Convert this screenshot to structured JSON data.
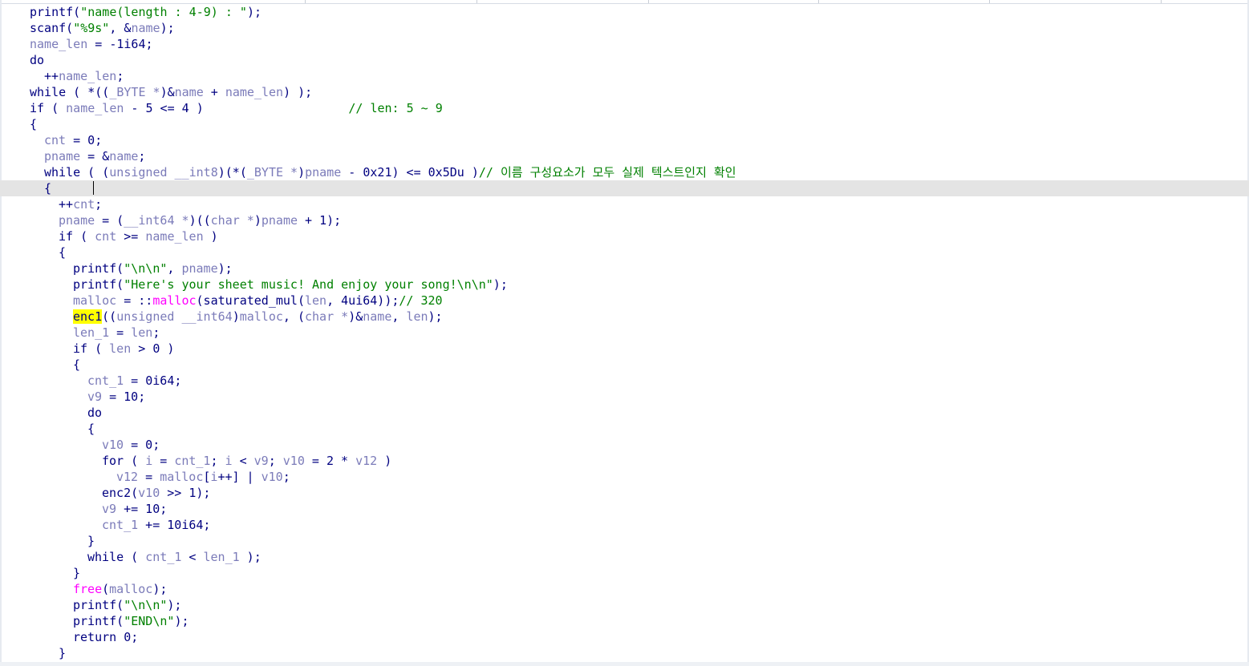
{
  "editor": {
    "current_line": 11,
    "lines": [
      {
        "indent": 0,
        "tokens": [
          [
            "kw",
            "printf("
          ],
          [
            "str",
            "\"name(length : 4-9) : \""
          ],
          [
            "kw",
            ");"
          ]
        ]
      },
      {
        "indent": 0,
        "tokens": [
          [
            "kw",
            "scanf("
          ],
          [
            "str",
            "\"%9s\""
          ],
          [
            "kw",
            ", &"
          ],
          [
            "var",
            "name"
          ],
          [
            "kw",
            ");"
          ]
        ]
      },
      {
        "indent": 0,
        "tokens": [
          [
            "var",
            "name_len"
          ],
          [
            "kw",
            " = -1i64;"
          ]
        ]
      },
      {
        "indent": 0,
        "tokens": [
          [
            "kw",
            "do"
          ]
        ]
      },
      {
        "indent": 1,
        "tokens": [
          [
            "kw",
            "++"
          ],
          [
            "var",
            "name_len"
          ],
          [
            "kw",
            ";"
          ]
        ]
      },
      {
        "indent": 0,
        "tokens": [
          [
            "kw",
            "while ( *(("
          ],
          [
            "var",
            "_BYTE *"
          ],
          [
            "kw",
            ")&"
          ],
          [
            "var",
            "name"
          ],
          [
            "kw",
            " + "
          ],
          [
            "var",
            "name_len"
          ],
          [
            "kw",
            ") );"
          ]
        ]
      },
      {
        "indent": 0,
        "tokens": [
          [
            "kw",
            "if ( "
          ],
          [
            "var",
            "name_len"
          ],
          [
            "kw",
            " - 5 <= 4 )                    "
          ],
          [
            "com",
            "// len: 5 ~ 9"
          ]
        ]
      },
      {
        "indent": 0,
        "tokens": [
          [
            "kw",
            "{"
          ]
        ]
      },
      {
        "indent": 1,
        "tokens": [
          [
            "var",
            "cnt"
          ],
          [
            "kw",
            " = 0;"
          ]
        ]
      },
      {
        "indent": 1,
        "tokens": [
          [
            "var",
            "pname"
          ],
          [
            "kw",
            " = &"
          ],
          [
            "var",
            "name"
          ],
          [
            "kw",
            ";"
          ]
        ]
      },
      {
        "indent": 1,
        "tokens": [
          [
            "kw",
            "while ( ("
          ],
          [
            "var",
            "unsigned __int8"
          ],
          [
            "kw",
            ")(*("
          ],
          [
            "var",
            "_BYTE *"
          ],
          [
            "kw",
            ")"
          ],
          [
            "var",
            "pname"
          ],
          [
            "kw",
            " - 0x21) <= 0x5Du )"
          ],
          [
            "com",
            "// 이름 구성요소가 모두 실제 텍스트인지 확인"
          ]
        ]
      },
      {
        "indent": 1,
        "tokens": [
          [
            "kw",
            "{"
          ]
        ],
        "caret": true
      },
      {
        "indent": 2,
        "tokens": [
          [
            "kw",
            "++"
          ],
          [
            "var",
            "cnt"
          ],
          [
            "kw",
            ";"
          ]
        ]
      },
      {
        "indent": 2,
        "tokens": [
          [
            "var",
            "pname"
          ],
          [
            "kw",
            " = ("
          ],
          [
            "var",
            "__int64 *"
          ],
          [
            "kw",
            ")(("
          ],
          [
            "var",
            "char *"
          ],
          [
            "kw",
            ")"
          ],
          [
            "var",
            "pname"
          ],
          [
            "kw",
            " + 1);"
          ]
        ]
      },
      {
        "indent": 2,
        "tokens": [
          [
            "kw",
            "if ( "
          ],
          [
            "var",
            "cnt"
          ],
          [
            "kw",
            " >= "
          ],
          [
            "var",
            "name_len"
          ],
          [
            "kw",
            " )"
          ]
        ]
      },
      {
        "indent": 2,
        "tokens": [
          [
            "kw",
            "{"
          ]
        ]
      },
      {
        "indent": 3,
        "tokens": [
          [
            "kw",
            "printf("
          ],
          [
            "str",
            "\"\\n\\n\""
          ],
          [
            "kw",
            ", "
          ],
          [
            "var",
            "pname"
          ],
          [
            "kw",
            ");"
          ]
        ]
      },
      {
        "indent": 3,
        "tokens": [
          [
            "kw",
            "printf("
          ],
          [
            "str",
            "\"Here's your sheet music! And enjoy your song!\\n\\n\""
          ],
          [
            "kw",
            ");"
          ]
        ]
      },
      {
        "indent": 3,
        "tokens": [
          [
            "var",
            "malloc"
          ],
          [
            "kw",
            " = ::"
          ],
          [
            "func",
            "malloc"
          ],
          [
            "kw",
            "(saturated_mul("
          ],
          [
            "var",
            "len"
          ],
          [
            "kw",
            ", 4ui64));"
          ],
          [
            "com",
            "// 320"
          ]
        ]
      },
      {
        "indent": 3,
        "tokens": [
          [
            "hl",
            "enc1"
          ],
          [
            "kw",
            "(("
          ],
          [
            "var",
            "unsigned __int64"
          ],
          [
            "kw",
            ")"
          ],
          [
            "var",
            "malloc"
          ],
          [
            "kw",
            ", ("
          ],
          [
            "var",
            "char *"
          ],
          [
            "kw",
            ")&"
          ],
          [
            "var",
            "name"
          ],
          [
            "kw",
            ", "
          ],
          [
            "var",
            "len"
          ],
          [
            "kw",
            ");"
          ]
        ]
      },
      {
        "indent": 3,
        "tokens": [
          [
            "var",
            "len_1"
          ],
          [
            "kw",
            " = "
          ],
          [
            "var",
            "len"
          ],
          [
            "kw",
            ";"
          ]
        ]
      },
      {
        "indent": 3,
        "tokens": [
          [
            "kw",
            "if ( "
          ],
          [
            "var",
            "len"
          ],
          [
            "kw",
            " > 0 )"
          ]
        ]
      },
      {
        "indent": 3,
        "tokens": [
          [
            "kw",
            "{"
          ]
        ]
      },
      {
        "indent": 4,
        "tokens": [
          [
            "var",
            "cnt_1"
          ],
          [
            "kw",
            " = 0i64;"
          ]
        ]
      },
      {
        "indent": 4,
        "tokens": [
          [
            "var",
            "v9"
          ],
          [
            "kw",
            " = 10;"
          ]
        ]
      },
      {
        "indent": 4,
        "tokens": [
          [
            "kw",
            "do"
          ]
        ]
      },
      {
        "indent": 4,
        "tokens": [
          [
            "kw",
            "{"
          ]
        ]
      },
      {
        "indent": 5,
        "tokens": [
          [
            "var",
            "v10"
          ],
          [
            "kw",
            " = 0;"
          ]
        ]
      },
      {
        "indent": 5,
        "tokens": [
          [
            "kw",
            "for ( "
          ],
          [
            "var",
            "i"
          ],
          [
            "kw",
            " = "
          ],
          [
            "var",
            "cnt_1"
          ],
          [
            "kw",
            "; "
          ],
          [
            "var",
            "i"
          ],
          [
            "kw",
            " < "
          ],
          [
            "var",
            "v9"
          ],
          [
            "kw",
            "; "
          ],
          [
            "var",
            "v10"
          ],
          [
            "kw",
            " = 2 * "
          ],
          [
            "var",
            "v12"
          ],
          [
            "kw",
            " )"
          ]
        ]
      },
      {
        "indent": 6,
        "tokens": [
          [
            "var",
            "v12"
          ],
          [
            "kw",
            " = "
          ],
          [
            "var",
            "malloc"
          ],
          [
            "kw",
            "["
          ],
          [
            "var",
            "i"
          ],
          [
            "kw",
            "++] | "
          ],
          [
            "var",
            "v10"
          ],
          [
            "kw",
            ";"
          ]
        ]
      },
      {
        "indent": 5,
        "tokens": [
          [
            "kw",
            "enc2("
          ],
          [
            "var",
            "v10"
          ],
          [
            "kw",
            " >> 1);"
          ]
        ]
      },
      {
        "indent": 5,
        "tokens": [
          [
            "var",
            "v9"
          ],
          [
            "kw",
            " += 10;"
          ]
        ]
      },
      {
        "indent": 5,
        "tokens": [
          [
            "var",
            "cnt_1"
          ],
          [
            "kw",
            " += 10i64;"
          ]
        ]
      },
      {
        "indent": 4,
        "tokens": [
          [
            "kw",
            "}"
          ]
        ]
      },
      {
        "indent": 4,
        "tokens": [
          [
            "kw",
            "while ( "
          ],
          [
            "var",
            "cnt_1"
          ],
          [
            "kw",
            " < "
          ],
          [
            "var",
            "len_1"
          ],
          [
            "kw",
            " );"
          ]
        ]
      },
      {
        "indent": 3,
        "tokens": [
          [
            "kw",
            "}"
          ]
        ]
      },
      {
        "indent": 3,
        "tokens": [
          [
            "func",
            "free"
          ],
          [
            "kw",
            "("
          ],
          [
            "var",
            "malloc"
          ],
          [
            "kw",
            ");"
          ]
        ]
      },
      {
        "indent": 3,
        "tokens": [
          [
            "kw",
            "printf("
          ],
          [
            "str",
            "\"\\n\\n\""
          ],
          [
            "kw",
            ");"
          ]
        ]
      },
      {
        "indent": 3,
        "tokens": [
          [
            "kw",
            "printf("
          ],
          [
            "str",
            "\"END\\n\""
          ],
          [
            "kw",
            ");"
          ]
        ]
      },
      {
        "indent": 3,
        "tokens": [
          [
            "kw",
            "return 0;"
          ]
        ]
      },
      {
        "indent": 2,
        "tokens": [
          [
            "kw",
            "}"
          ]
        ]
      }
    ]
  }
}
